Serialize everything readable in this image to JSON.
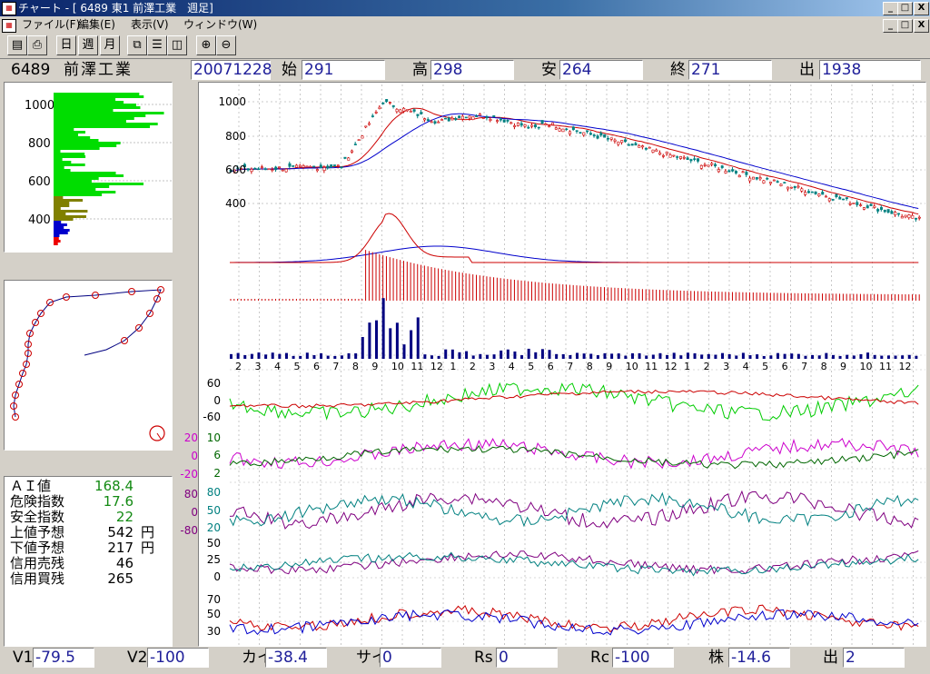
{
  "window": {
    "title": "チャート - [ 6489 東1 前澤工業　週足]",
    "buttons": [
      "_",
      "□",
      "X"
    ]
  },
  "menu": [
    "ファイル(F)",
    "編集(E)",
    "表示(V)",
    "ウィンドウ(W)"
  ],
  "toolbar": {
    "day": "日",
    "week": "週",
    "month": "月"
  },
  "info": {
    "code": "6489",
    "name": "前澤工業",
    "date": "20071228",
    "open_label": "始",
    "open": "291",
    "high_label": "高",
    "high": "298",
    "low_label": "安",
    "low": "264",
    "close_label": "終",
    "close": "271",
    "vol_label": "出",
    "vol": "1938"
  },
  "profile_axis": [
    "1000",
    "800",
    "600",
    "400"
  ],
  "ai": {
    "rows": [
      {
        "label": "ＡＩ値",
        "value": "168.4",
        "unit": ""
      },
      {
        "label": "危険指数",
        "value": "17.6",
        "unit": ""
      },
      {
        "label": "安全指数",
        "value": "22",
        "unit": ""
      },
      {
        "label": "上値予想",
        "value": "542",
        "unit": "円"
      },
      {
        "label": "下値予想",
        "value": "217",
        "unit": "円"
      },
      {
        "label": "信用売残",
        "value": "46",
        "unit": ""
      },
      {
        "label": "信用買残",
        "value": "265",
        "unit": ""
      }
    ]
  },
  "price_axis": [
    "1000",
    "800",
    "600",
    "400"
  ],
  "months": [
    "2",
    "3",
    "4",
    "5",
    "6",
    "7",
    "8",
    "9",
    "10",
    "11",
    "12",
    "1",
    "2",
    "3",
    "4",
    "5",
    "6",
    "7",
    "8",
    "9",
    "10",
    "11",
    "12",
    "1",
    "2",
    "3",
    "4",
    "5",
    "6",
    "7",
    "8",
    "9",
    "10",
    "11",
    "12"
  ],
  "osc_axes": {
    "p1": [
      "60",
      "0",
      "-60"
    ],
    "p2_left": [
      "20",
      "0",
      "-20"
    ],
    "p2_right": [
      "10",
      "6",
      "2"
    ],
    "p3_left": [
      "80",
      "0",
      "-80"
    ],
    "p3_right": [
      "80",
      "50",
      "20"
    ],
    "p4": [
      "50",
      "25",
      "0"
    ],
    "p5": [
      "70",
      "50",
      "30"
    ]
  },
  "bottom": {
    "v1_label": "V1",
    "v1": "-79.5",
    "v2_label": "V2",
    "v2": "-100",
    "kai_label": "カイ",
    "kai": "-38.4",
    "sai_label": "サイ",
    "sai": "0",
    "rs_label": "Rs",
    "rs": "0",
    "rc_label": "Rc",
    "rc": "-100",
    "kabu_label": "株",
    "kabu": "-14.6",
    "de_label": "出",
    "de": "2"
  },
  "colors": {
    "up": "#cc0000",
    "down": "#008080",
    "ma_short": "#cc0000",
    "ma_long": "#0000cc",
    "volume": "#000080",
    "green": "#00cc00",
    "magenta": "#cc00cc"
  }
}
